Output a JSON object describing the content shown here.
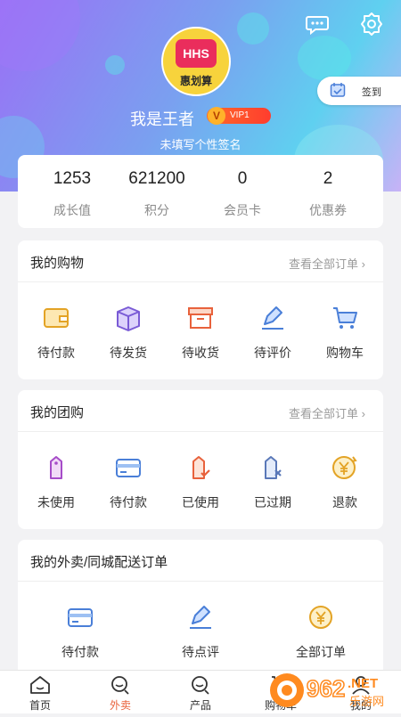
{
  "header": {
    "signin_label": "签到",
    "username": "我是王者",
    "vip_badge": "VIP1",
    "signature": "未填写个性签名",
    "logo_text": "惠划算"
  },
  "stats": [
    {
      "value": "1253",
      "label": "成长值"
    },
    {
      "value": "621200",
      "label": "积分"
    },
    {
      "value": "0",
      "label": "会员卡"
    },
    {
      "value": "2",
      "label": "优惠券"
    }
  ],
  "shopping": {
    "title": "我的购物",
    "link": "查看全部订单",
    "items": [
      {
        "label": "待付款",
        "icon": "wallet-icon"
      },
      {
        "label": "待发货",
        "icon": "package-icon"
      },
      {
        "label": "待收货",
        "icon": "box-icon"
      },
      {
        "label": "待评价",
        "icon": "pen-icon"
      },
      {
        "label": "购物车",
        "icon": "cart-icon"
      }
    ]
  },
  "group": {
    "title": "我的团购",
    "link": "查看全部订单",
    "items": [
      {
        "label": "未使用",
        "icon": "tag-icon"
      },
      {
        "label": "待付款",
        "icon": "card-icon"
      },
      {
        "label": "已使用",
        "icon": "tag-check-icon"
      },
      {
        "label": "已过期",
        "icon": "tag-x-icon"
      },
      {
        "label": "退款",
        "icon": "refund-icon"
      }
    ]
  },
  "delivery": {
    "title": "我的外卖/同城配送订单",
    "items": [
      {
        "label": "待付款",
        "icon": "card-icon"
      },
      {
        "label": "待点评",
        "icon": "pen-icon"
      },
      {
        "label": "全部订单",
        "icon": "yen-icon"
      }
    ]
  },
  "tabbar": [
    {
      "label": "首页",
      "icon": "home-icon"
    },
    {
      "label": "外卖",
      "icon": "takeout-icon"
    },
    {
      "label": "产品",
      "icon": "product-icon"
    },
    {
      "label": "购物车",
      "icon": "cart-icon"
    },
    {
      "label": "我的",
      "icon": "user-icon"
    }
  ],
  "colors": {
    "accent": "#e8623c",
    "icon_purple": "#7a5bd6",
    "icon_blue": "#4a7fd8",
    "icon_orange": "#e8623c",
    "icon_yellow": "#e3a325"
  },
  "watermark": {
    "text": "962",
    "suffix": ".NET",
    "subtext": "乐游网"
  }
}
